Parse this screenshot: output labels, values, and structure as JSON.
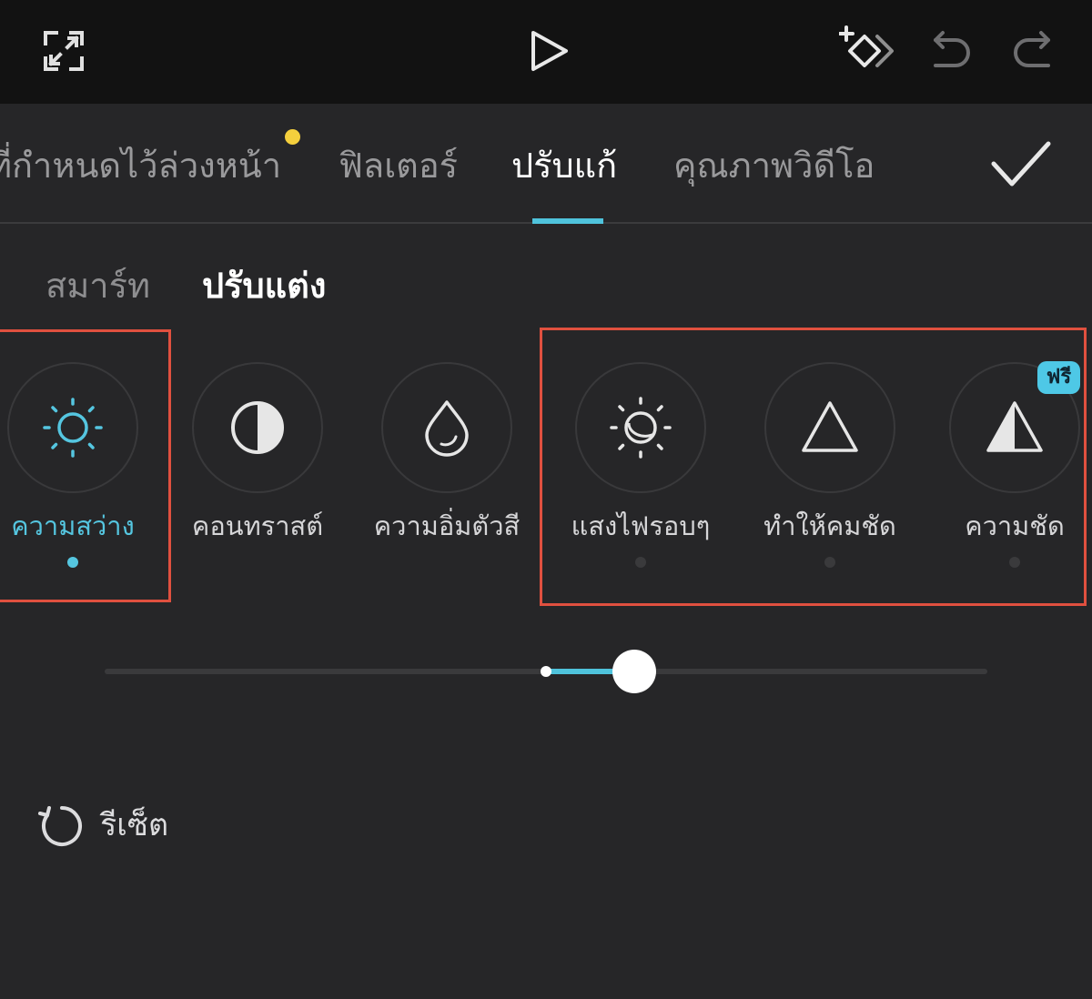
{
  "topbar": {
    "icons": [
      "fullscreen-icon",
      "play-icon",
      "add-keyframe-icon",
      "undo-icon",
      "redo-icon"
    ]
  },
  "tabs": {
    "items": [
      {
        "label": "ที่กำหนดไว้ล่วงหน้า",
        "active": false,
        "badge_dot": true
      },
      {
        "label": "ฟิลเตอร์",
        "active": false
      },
      {
        "label": "ปรับแก้",
        "active": true
      },
      {
        "label": "คุณภาพวิดีโอ",
        "active": false
      }
    ],
    "confirm_icon": "check-icon"
  },
  "subtabs": [
    {
      "label": "สมาร์ท",
      "active": false
    },
    {
      "label": "ปรับแต่ง",
      "active": true
    }
  ],
  "tools": [
    {
      "label": "ความสว่าง",
      "icon": "sun-icon",
      "active": true
    },
    {
      "label": "คอนทราสต์",
      "icon": "contrast-icon",
      "active": false
    },
    {
      "label": "ความอิ่มตัวสี",
      "icon": "droplet-icon",
      "active": false
    },
    {
      "label": "แสงไฟรอบๆ",
      "icon": "ambient-light-icon",
      "active": false
    },
    {
      "label": "ทำให้คมชัด",
      "icon": "triangle-icon",
      "active": false
    },
    {
      "label": "ความชัด",
      "icon": "split-triangle-icon",
      "active": false,
      "badge": "ฟรี"
    }
  ],
  "slider": {
    "min": -50,
    "max": 50,
    "value": 10
  },
  "reset": {
    "label": "รีเซ็ต",
    "icon": "reset-icon"
  },
  "colors": {
    "accent": "#4fc3dc",
    "highlight_box": "#e0503f",
    "badge_dot": "#f4cf3d",
    "background": "#262628",
    "topbar": "#121212"
  }
}
